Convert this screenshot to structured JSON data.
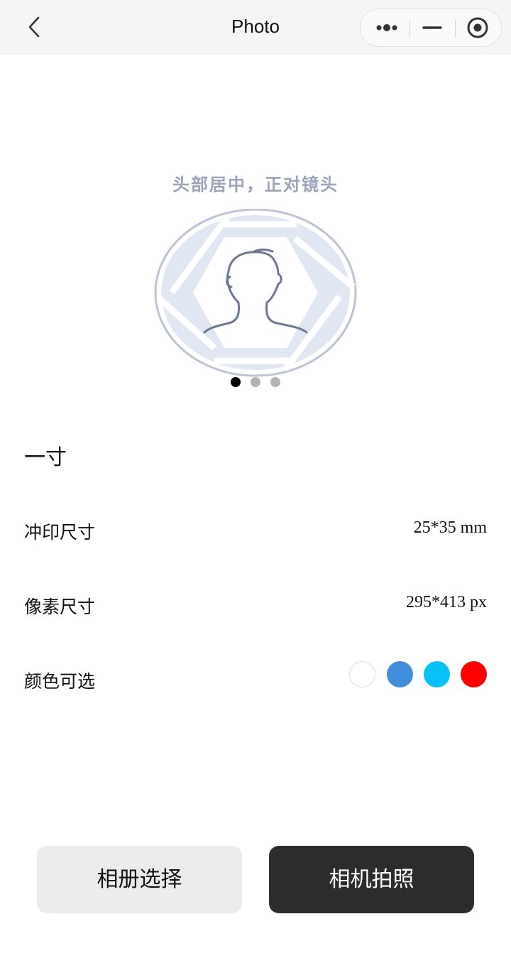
{
  "navbar": {
    "title": "Photo",
    "back_icon": "chevron-left-icon",
    "more_icon": "more-dots-icon",
    "minimize_icon": "minimize-icon",
    "close_icon": "target-circle-icon"
  },
  "guide": {
    "hint": "头部居中，正对镜头",
    "illustration_icon": "portrait-aperture-icon"
  },
  "carousel": {
    "count": 3,
    "active_index": 0
  },
  "spec": {
    "title": "一寸",
    "rows": [
      {
        "label": "冲印尺寸",
        "value": "25*35 mm"
      },
      {
        "label": "像素尺寸",
        "value": "295*413 px"
      }
    ],
    "color_label": "颜色可选",
    "colors": [
      "#ffffff",
      "#438edb",
      "#07c0f5",
      "#ff0000"
    ]
  },
  "actions": {
    "album_label": "相册选择",
    "camera_label": "相机拍照"
  }
}
